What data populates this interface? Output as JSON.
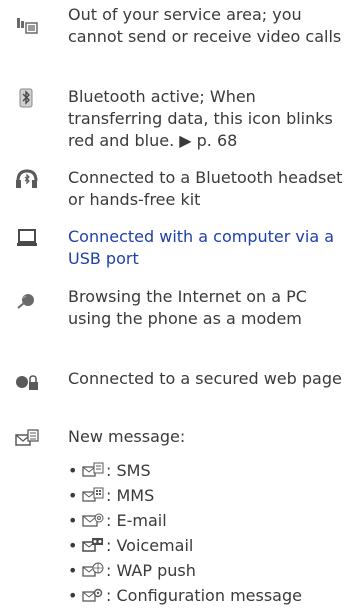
{
  "entries": [
    {
      "icon": "no-service-video-icon",
      "text": "Out of your service area; you cannot send or receive video calls"
    },
    {
      "icon": "bluetooth-icon",
      "text": "Bluetooth active; When transferring data, this icon blinks red and blue. ▶ p. 68"
    },
    {
      "icon": "bluetooth-headset-icon",
      "text": "Connected to a Bluetooth headset or hands-free kit"
    },
    {
      "icon": "computer-icon",
      "text": "Connected with a computer via a USB port"
    },
    {
      "icon": "internet-browsing-icon",
      "text": "Browsing the Internet on a PC using the phone as a modem"
    },
    {
      "icon": "secured-web-icon",
      "text": "Connected to a secured web page"
    },
    {
      "icon": "new-message-icon",
      "text": "New message:"
    }
  ],
  "message_types": [
    {
      "icon": "sms-icon",
      "label": ": SMS"
    },
    {
      "icon": "mms-icon",
      "label": ": MMS"
    },
    {
      "icon": "email-icon",
      "label": ": E-mail"
    },
    {
      "icon": "voicemail-icon",
      "label": ": Voicemail"
    },
    {
      "icon": "wap-push-icon",
      "label": ": WAP push"
    },
    {
      "icon": "configuration-message-icon",
      "label": ": Configuration message"
    }
  ],
  "bullet_char": "•",
  "colors": {
    "text": "#3a3a3a",
    "link": "#1f40a8",
    "icon": "#5a5a5a"
  }
}
